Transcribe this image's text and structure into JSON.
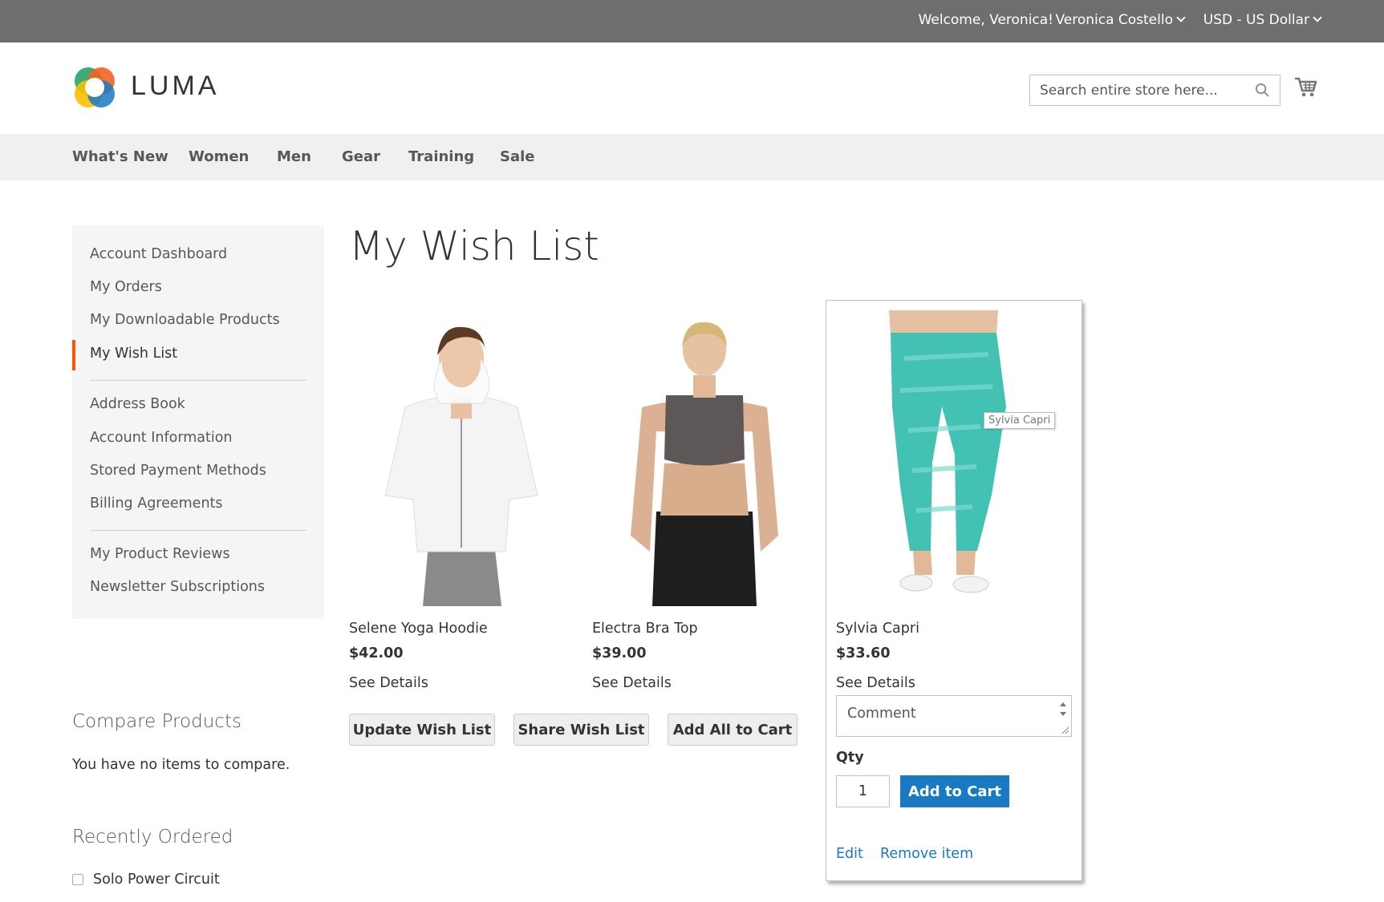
{
  "top_bar": {
    "welcome": "Welcome, Veronica!",
    "customer_name": "Veronica Costello",
    "currency": "USD - US Dollar"
  },
  "header": {
    "logo_text": "LUMA",
    "search_placeholder": "Search entire store here..."
  },
  "nav": {
    "items": [
      "What's New",
      "Women",
      "Men",
      "Gear",
      "Training",
      "Sale"
    ]
  },
  "sidebar": {
    "items": [
      "Account Dashboard",
      "My Orders",
      "My Downloadable Products",
      "My Wish List",
      "Address Book",
      "Account Information",
      "Stored Payment Methods",
      "Billing Agreements",
      "My Product Reviews",
      "Newsletter Subscriptions"
    ],
    "active": "My Wish List"
  },
  "compare": {
    "title": "Compare Products",
    "empty_text": "You have no items to compare."
  },
  "recently_ordered": {
    "title": "Recently Ordered",
    "items": [
      "Solo Power Circuit"
    ]
  },
  "page": {
    "title": "My Wish List"
  },
  "products": [
    {
      "name": "Selene Yoga Hoodie",
      "price": "$42.00",
      "details": "See Details"
    },
    {
      "name": "Electra Bra Top",
      "price": "$39.00",
      "details": "See Details"
    },
    {
      "name": "Sylvia Capri",
      "price": "$33.60",
      "details": "See Details"
    }
  ],
  "tooltip": "Sylvia Capri",
  "hovered_item": {
    "comment_placeholder": "Comment",
    "qty_label": "Qty",
    "qty_value": "1",
    "add_to_cart": "Add to Cart",
    "edit": "Edit",
    "remove": "Remove item"
  },
  "actions": {
    "update": "Update Wish List",
    "share": "Share Wish List",
    "add_all": "Add All to Cart"
  },
  "colors": {
    "top_bar": "#6e6e6c",
    "nav_bg": "#f0f0f0",
    "active_marker": "#ff5501",
    "primary": "#1979c3",
    "link": "#1979c3"
  },
  "icons": {
    "search": "search-icon",
    "cart": "cart-icon",
    "dropdown": "chevron-down-icon"
  }
}
